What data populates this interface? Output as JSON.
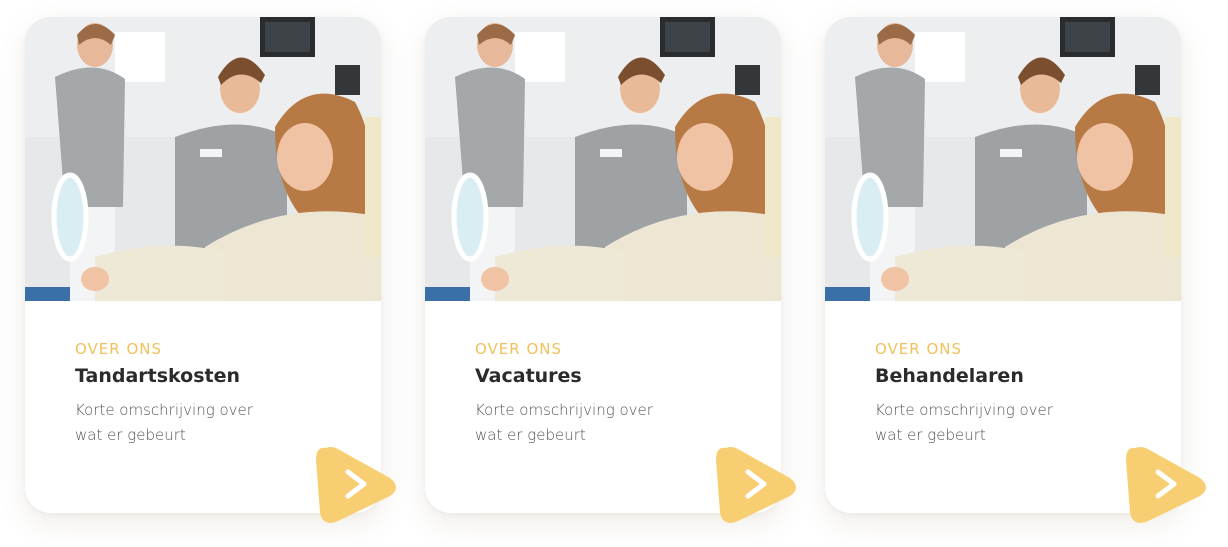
{
  "cards": [
    {
      "eyebrow": "OVER ONS",
      "title": "Tandartskosten",
      "description": "Korte omschrijving over wat er gebeurt",
      "image_icon": "dental-clinic-photo-icon",
      "arrow_icon": "chevron-right-icon"
    },
    {
      "eyebrow": "OVER ONS",
      "title": "Vacatures",
      "description": "Korte omschrijving over wat er gebeurt",
      "image_icon": "dental-clinic-photo-icon",
      "arrow_icon": "chevron-right-icon"
    },
    {
      "eyebrow": "OVER ONS",
      "title": "Behandelaren",
      "description": "Korte omschrijving over wat er gebeurt",
      "image_icon": "dental-clinic-photo-icon",
      "arrow_icon": "chevron-right-icon"
    }
  ],
  "colors": {
    "accent": "#f0c15a",
    "arrow_fill": "#f7cf72",
    "title": "#2b2b2b",
    "text": "#555555"
  }
}
